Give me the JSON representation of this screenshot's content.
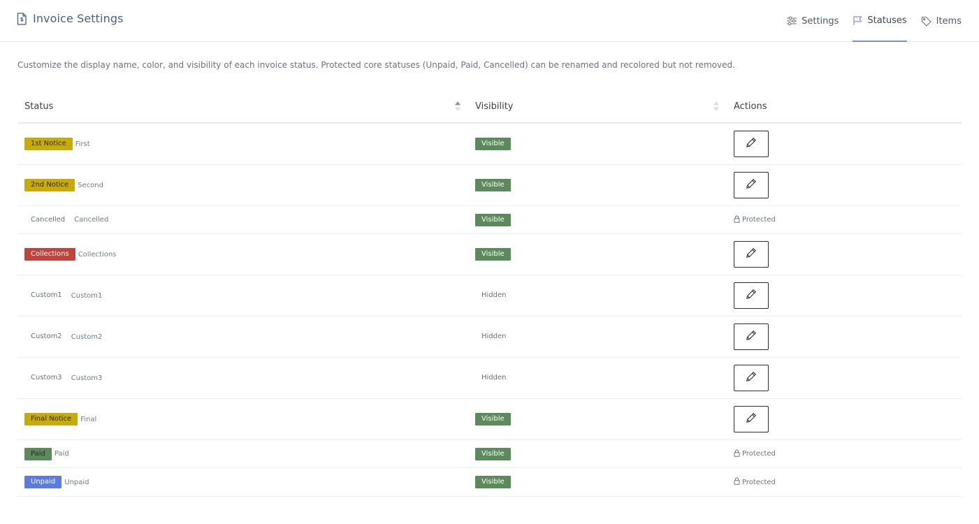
{
  "header": {
    "title": "Invoice Settings",
    "title_icon": "invoice-file-icon",
    "nav": [
      {
        "label": "Settings",
        "icon": "sliders-icon",
        "active": false
      },
      {
        "label": "Statuses",
        "icon": "flag-icon",
        "active": true
      },
      {
        "label": "Items",
        "icon": "tag-icon",
        "active": false
      }
    ]
  },
  "description": "Customize the display name, color, and visibility of each invoice status. Protected core statuses (Unpaid, Paid, Cancelled) can be renamed and recolored but not removed.",
  "table": {
    "columns": {
      "status": "Status",
      "visibility": "Visibility",
      "actions": "Actions"
    },
    "rows": [
      {
        "name": "1st Notice",
        "sub": "First",
        "color": "#c8aa08",
        "visibility": "Visible",
        "visible": true,
        "action": "edit"
      },
      {
        "name": "2nd Notice",
        "sub": "Second",
        "color": "#c8aa08",
        "visibility": "Visible",
        "visible": true,
        "action": "edit"
      },
      {
        "name": "Cancelled",
        "sub": "Cancelled",
        "color": "",
        "visibility": "Visible",
        "visible": true,
        "action": "protected",
        "protected_label": "Protected"
      },
      {
        "name": "Collections",
        "sub": "Collections",
        "color": "#c0433c",
        "text_color": "#ffffff",
        "visibility": "Visible",
        "visible": true,
        "action": "edit"
      },
      {
        "name": "Custom1",
        "sub": "Custom1",
        "color": "",
        "visibility": "Hidden",
        "visible": false,
        "action": "edit"
      },
      {
        "name": "Custom2",
        "sub": "Custom2",
        "color": "",
        "visibility": "Hidden",
        "visible": false,
        "action": "edit"
      },
      {
        "name": "Custom3",
        "sub": "Custom3",
        "color": "",
        "visibility": "Hidden",
        "visible": false,
        "action": "edit"
      },
      {
        "name": "Final Notice",
        "sub": "Final",
        "color": "#c8aa08",
        "visibility": "Visible",
        "visible": true,
        "action": "edit"
      },
      {
        "name": "Paid",
        "sub": "Paid",
        "color": "#5b8a5b",
        "visibility": "Visible",
        "visible": true,
        "action": "protected",
        "protected_label": "Protected"
      },
      {
        "name": "Unpaid",
        "sub": "Unpaid",
        "color": "#5b7be0",
        "text_color": "#ffffff",
        "visibility": "Visible",
        "visible": true,
        "action": "protected",
        "protected_label": "Protected"
      }
    ]
  },
  "colors": {
    "visible_badge": "#5b8a5b",
    "nav_active_underline": "#7f8fd6",
    "title": "#4f5b8a"
  }
}
